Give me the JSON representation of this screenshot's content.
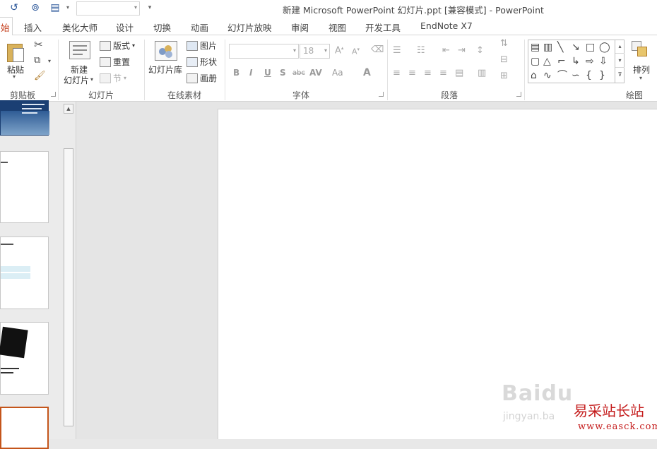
{
  "window": {
    "title": "新建 Microsoft PowerPoint 幻灯片.ppt [兼容模式] - PowerPoint"
  },
  "quick_access": {
    "undo_icon": "undo-icon",
    "present_icon": "present-icon",
    "customize_icon": "customize-icon",
    "overflow": "▾"
  },
  "tabs": [
    "始",
    "插入",
    "美化大师",
    "设计",
    "切换",
    "动画",
    "幻灯片放映",
    "审阅",
    "视图",
    "开发工具",
    "EndNote X7"
  ],
  "ribbon": {
    "clipboard": {
      "paste": "粘贴",
      "label": "剪贴板"
    },
    "slides": {
      "new_slide_line1": "新建",
      "new_slide_line2": "幻灯片",
      "layout": "版式",
      "reset": "重置",
      "section": "节",
      "label": "幻灯片"
    },
    "online": {
      "library": "幻灯片库",
      "picture": "图片",
      "shape": "形状",
      "album": "画册",
      "label": "在线素材"
    },
    "font": {
      "size": "18",
      "label": "字体"
    },
    "paragraph": {
      "label": "段落"
    },
    "drawing": {
      "arrange": "排列",
      "label": "绘图"
    }
  },
  "watermarks": {
    "baidu": "Baidu",
    "baidu_sub": "jingyan.ba",
    "site": "易采站长站",
    "site_url": "www.easck.com"
  },
  "colors": {
    "accent": "#c43e1c",
    "selected_thumb": "#c4551b"
  }
}
